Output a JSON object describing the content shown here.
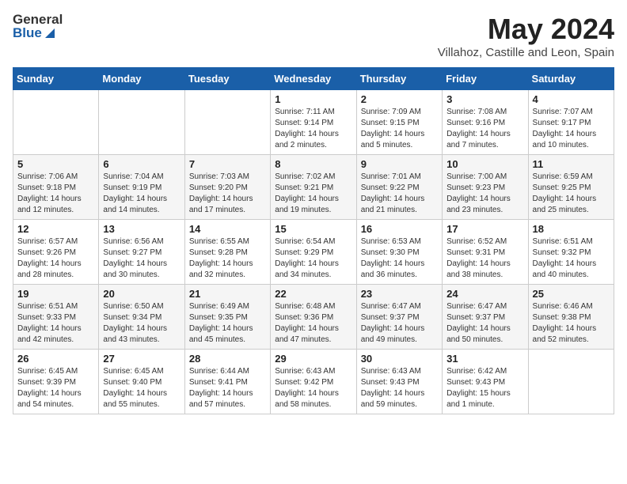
{
  "header": {
    "logo_general": "General",
    "logo_blue": "Blue",
    "month_title": "May 2024",
    "location": "Villahoz, Castille and Leon, Spain"
  },
  "weekdays": [
    "Sunday",
    "Monday",
    "Tuesday",
    "Wednesday",
    "Thursday",
    "Friday",
    "Saturday"
  ],
  "weeks": [
    [
      {
        "day": "",
        "sunrise": "",
        "sunset": "",
        "daylight": ""
      },
      {
        "day": "",
        "sunrise": "",
        "sunset": "",
        "daylight": ""
      },
      {
        "day": "",
        "sunrise": "",
        "sunset": "",
        "daylight": ""
      },
      {
        "day": "1",
        "sunrise": "7:11 AM",
        "sunset": "9:14 PM",
        "daylight": "14 hours and 2 minutes."
      },
      {
        "day": "2",
        "sunrise": "7:09 AM",
        "sunset": "9:15 PM",
        "daylight": "14 hours and 5 minutes."
      },
      {
        "day": "3",
        "sunrise": "7:08 AM",
        "sunset": "9:16 PM",
        "daylight": "14 hours and 7 minutes."
      },
      {
        "day": "4",
        "sunrise": "7:07 AM",
        "sunset": "9:17 PM",
        "daylight": "14 hours and 10 minutes."
      }
    ],
    [
      {
        "day": "5",
        "sunrise": "7:06 AM",
        "sunset": "9:18 PM",
        "daylight": "14 hours and 12 minutes."
      },
      {
        "day": "6",
        "sunrise": "7:04 AM",
        "sunset": "9:19 PM",
        "daylight": "14 hours and 14 minutes."
      },
      {
        "day": "7",
        "sunrise": "7:03 AM",
        "sunset": "9:20 PM",
        "daylight": "14 hours and 17 minutes."
      },
      {
        "day": "8",
        "sunrise": "7:02 AM",
        "sunset": "9:21 PM",
        "daylight": "14 hours and 19 minutes."
      },
      {
        "day": "9",
        "sunrise": "7:01 AM",
        "sunset": "9:22 PM",
        "daylight": "14 hours and 21 minutes."
      },
      {
        "day": "10",
        "sunrise": "7:00 AM",
        "sunset": "9:23 PM",
        "daylight": "14 hours and 23 minutes."
      },
      {
        "day": "11",
        "sunrise": "6:59 AM",
        "sunset": "9:25 PM",
        "daylight": "14 hours and 25 minutes."
      }
    ],
    [
      {
        "day": "12",
        "sunrise": "6:57 AM",
        "sunset": "9:26 PM",
        "daylight": "14 hours and 28 minutes."
      },
      {
        "day": "13",
        "sunrise": "6:56 AM",
        "sunset": "9:27 PM",
        "daylight": "14 hours and 30 minutes."
      },
      {
        "day": "14",
        "sunrise": "6:55 AM",
        "sunset": "9:28 PM",
        "daylight": "14 hours and 32 minutes."
      },
      {
        "day": "15",
        "sunrise": "6:54 AM",
        "sunset": "9:29 PM",
        "daylight": "14 hours and 34 minutes."
      },
      {
        "day": "16",
        "sunrise": "6:53 AM",
        "sunset": "9:30 PM",
        "daylight": "14 hours and 36 minutes."
      },
      {
        "day": "17",
        "sunrise": "6:52 AM",
        "sunset": "9:31 PM",
        "daylight": "14 hours and 38 minutes."
      },
      {
        "day": "18",
        "sunrise": "6:51 AM",
        "sunset": "9:32 PM",
        "daylight": "14 hours and 40 minutes."
      }
    ],
    [
      {
        "day": "19",
        "sunrise": "6:51 AM",
        "sunset": "9:33 PM",
        "daylight": "14 hours and 42 minutes."
      },
      {
        "day": "20",
        "sunrise": "6:50 AM",
        "sunset": "9:34 PM",
        "daylight": "14 hours and 43 minutes."
      },
      {
        "day": "21",
        "sunrise": "6:49 AM",
        "sunset": "9:35 PM",
        "daylight": "14 hours and 45 minutes."
      },
      {
        "day": "22",
        "sunrise": "6:48 AM",
        "sunset": "9:36 PM",
        "daylight": "14 hours and 47 minutes."
      },
      {
        "day": "23",
        "sunrise": "6:47 AM",
        "sunset": "9:37 PM",
        "daylight": "14 hours and 49 minutes."
      },
      {
        "day": "24",
        "sunrise": "6:47 AM",
        "sunset": "9:37 PM",
        "daylight": "14 hours and 50 minutes."
      },
      {
        "day": "25",
        "sunrise": "6:46 AM",
        "sunset": "9:38 PM",
        "daylight": "14 hours and 52 minutes."
      }
    ],
    [
      {
        "day": "26",
        "sunrise": "6:45 AM",
        "sunset": "9:39 PM",
        "daylight": "14 hours and 54 minutes."
      },
      {
        "day": "27",
        "sunrise": "6:45 AM",
        "sunset": "9:40 PM",
        "daylight": "14 hours and 55 minutes."
      },
      {
        "day": "28",
        "sunrise": "6:44 AM",
        "sunset": "9:41 PM",
        "daylight": "14 hours and 57 minutes."
      },
      {
        "day": "29",
        "sunrise": "6:43 AM",
        "sunset": "9:42 PM",
        "daylight": "14 hours and 58 minutes."
      },
      {
        "day": "30",
        "sunrise": "6:43 AM",
        "sunset": "9:43 PM",
        "daylight": "14 hours and 59 minutes."
      },
      {
        "day": "31",
        "sunrise": "6:42 AM",
        "sunset": "9:43 PM",
        "daylight": "15 hours and 1 minute."
      },
      {
        "day": "",
        "sunrise": "",
        "sunset": "",
        "daylight": ""
      }
    ]
  ],
  "labels": {
    "sunrise_prefix": "Sunrise: ",
    "sunset_prefix": "Sunset: ",
    "daylight_prefix": "Daylight: "
  }
}
